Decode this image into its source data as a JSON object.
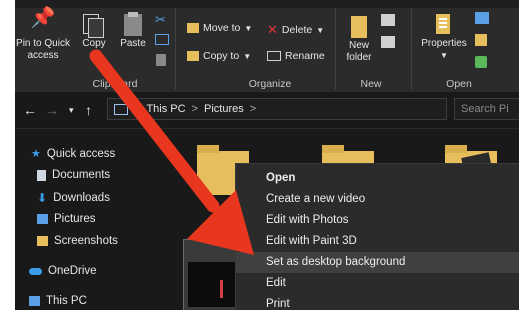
{
  "ribbon": {
    "pin_label_1": "Pin to Quick",
    "pin_label_2": "access",
    "copy_label": "Copy",
    "paste_label": "Paste",
    "clipboard_group": "Clipboard",
    "move_to_label": "Move to",
    "copy_to_label": "Copy to",
    "delete_label": "Delete",
    "rename_label": "Rename",
    "organize_group": "Organize",
    "new_folder_label_1": "New",
    "new_folder_label_2": "folder",
    "new_group": "New",
    "properties_label": "Properties",
    "open_group": "Open"
  },
  "address": {
    "crumb_1": "This PC",
    "crumb_2": "Pictures",
    "separator": ">",
    "search_placeholder": "Search Pi"
  },
  "sidebar": {
    "items": [
      {
        "label": "Quick access"
      },
      {
        "label": "Documents"
      },
      {
        "label": "Downloads"
      },
      {
        "label": "Pictures"
      },
      {
        "label": "Screenshots"
      },
      {
        "label": "OneDrive"
      },
      {
        "label": "This PC"
      }
    ]
  },
  "context_menu": {
    "items": [
      {
        "label": "Open"
      },
      {
        "label": "Create a new video"
      },
      {
        "label": "Edit with Photos"
      },
      {
        "label": "Edit with Paint 3D"
      },
      {
        "label": "Set as desktop background"
      },
      {
        "label": "Edit"
      },
      {
        "label": "Print"
      }
    ]
  },
  "colors": {
    "background": "#191919",
    "ribbon": "#2b2b2b",
    "menu": "#2b2b2b",
    "highlight": "#404040",
    "folder": "#e6be5c",
    "arrow": "#e8361f",
    "delete_x": "#e03131",
    "quick_access_star": "#3a9ee8"
  }
}
